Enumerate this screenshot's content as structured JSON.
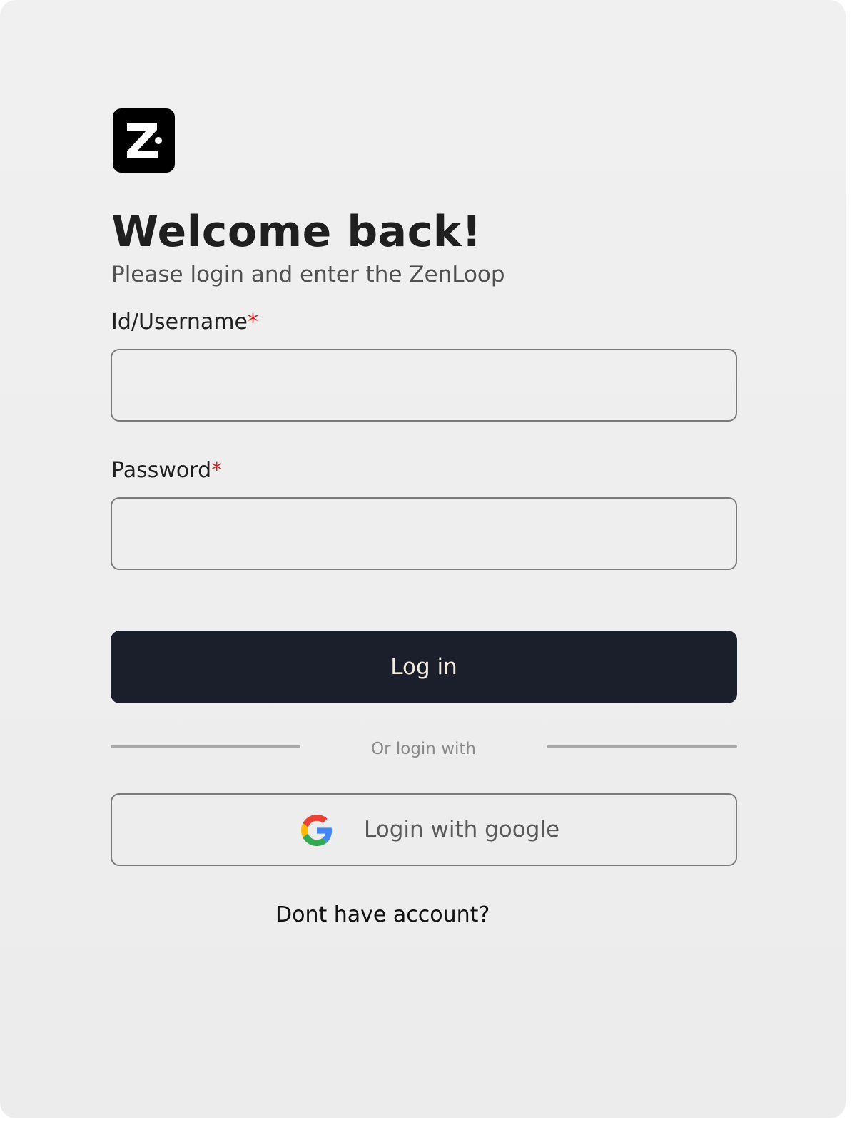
{
  "brand": {
    "logo_icon": "zenloop-logo-icon",
    "logo_letter": "Z"
  },
  "header": {
    "title": "Welcome back!",
    "subtitle": "Please login and enter the ZenLoop"
  },
  "form": {
    "username": {
      "label": "Id/Username",
      "required_mark": "*",
      "value": ""
    },
    "password": {
      "label": "Password",
      "required_mark": "*",
      "value": ""
    },
    "submit_label": "Log in"
  },
  "divider": {
    "text": "Or login  with"
  },
  "social": {
    "google_label": "Login with google",
    "google_icon": "google-icon"
  },
  "footer": {
    "signup_link": "Dont have account?"
  },
  "colors": {
    "background": "#efefef",
    "primary_button": "#1b1f2b",
    "primary_button_text": "#f4ecdd",
    "required": "#c4272b",
    "border": "#7a7a7a"
  }
}
